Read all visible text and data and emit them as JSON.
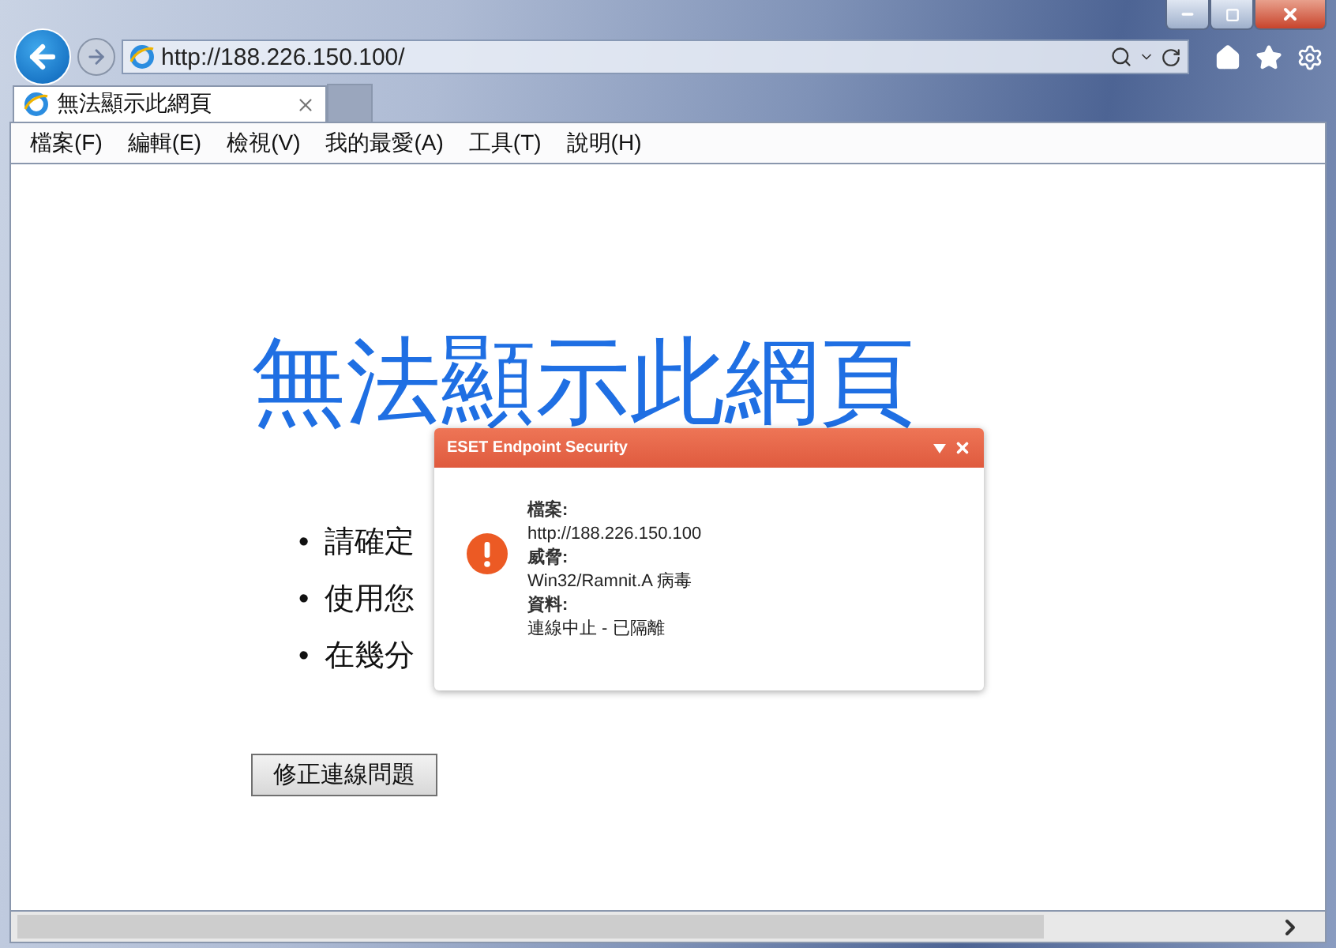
{
  "address_bar": {
    "value": "http://188.226.150.100/"
  },
  "tabs": [
    {
      "title": "無法顯示此網頁",
      "selected": true
    }
  ],
  "menu": [
    "檔案(F)",
    "編輯(E)",
    "檢視(V)",
    "我的最愛(A)",
    "工具(T)",
    "說明(H)"
  ],
  "page": {
    "heading": "無法顯示此網頁",
    "bullets": [
      {
        "marker": "•",
        "text": "請確定"
      },
      {
        "marker": "•",
        "text": "使用您"
      },
      {
        "marker": "•",
        "text": "在幾分"
      }
    ],
    "button": "修正連線問題"
  },
  "popup": {
    "title": "ESET Endpoint Security",
    "fields": [
      {
        "label": "檔案:",
        "value": "http://188.226.150.100"
      },
      {
        "label": "威脅:",
        "value": "Win32/Ramnit.A 病毒"
      },
      {
        "label": "資料:",
        "value": "連線中止 - 已隔離"
      }
    ]
  }
}
